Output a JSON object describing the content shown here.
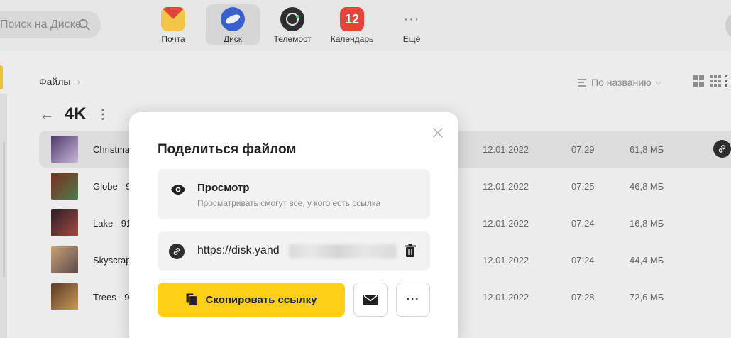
{
  "search": {
    "text": "Поиск на Диске"
  },
  "apps": [
    {
      "label": "Почта",
      "icon": "mail-icon"
    },
    {
      "label": "Диск",
      "icon": "disk-icon",
      "active": true
    },
    {
      "label": "Телемост",
      "icon": "telemost-icon"
    },
    {
      "label": "Календарь",
      "icon": "calendar-icon",
      "badge": "12"
    },
    {
      "label": "Ещё",
      "icon": "more-icon",
      "glyph": "···"
    }
  ],
  "breadcrumb": {
    "root": "Файлы",
    "arrow": "›"
  },
  "sort": {
    "label": "По названию",
    "chevron": "⌵"
  },
  "folder": {
    "back": "←",
    "title": "4K",
    "menu": "⋮"
  },
  "files": [
    {
      "name": "Christmas",
      "date": "12.01.2022",
      "time": "07:29",
      "size": "61,8 МБ",
      "thumb": [
        "#4b3a6a",
        "#c8b6d8"
      ]
    },
    {
      "name": "Globe - 9",
      "date": "12.01.2022",
      "time": "07:25",
      "size": "46,8 МБ",
      "thumb": [
        "#7a2e22",
        "#4f7b4a"
      ]
    },
    {
      "name": "Lake - 91",
      "date": "12.01.2022",
      "time": "07:24",
      "size": "16,8 МБ",
      "thumb": [
        "#2a1e24",
        "#a84a45"
      ]
    },
    {
      "name": "Skyscrap",
      "date": "12.01.2022",
      "time": "07:24",
      "size": "44,4 МБ",
      "thumb": [
        "#c9a178",
        "#5b4a4a"
      ]
    },
    {
      "name": "Trees - 9",
      "date": "12.01.2022",
      "time": "07:28",
      "size": "72,6 МБ",
      "thumb": [
        "#5a3a24",
        "#c99a5a"
      ]
    }
  ],
  "dialog": {
    "title": "Поделиться файлом",
    "access_title": "Просмотр",
    "access_sub": "Просматривать смогут все, у кого есть ссылка",
    "link_text": "https://disk.yand",
    "copy_label": "Скопировать ссылку",
    "more_glyph": "···"
  },
  "colors": {
    "accent": "#fdd017",
    "selected_row": "#dcdcdc"
  }
}
